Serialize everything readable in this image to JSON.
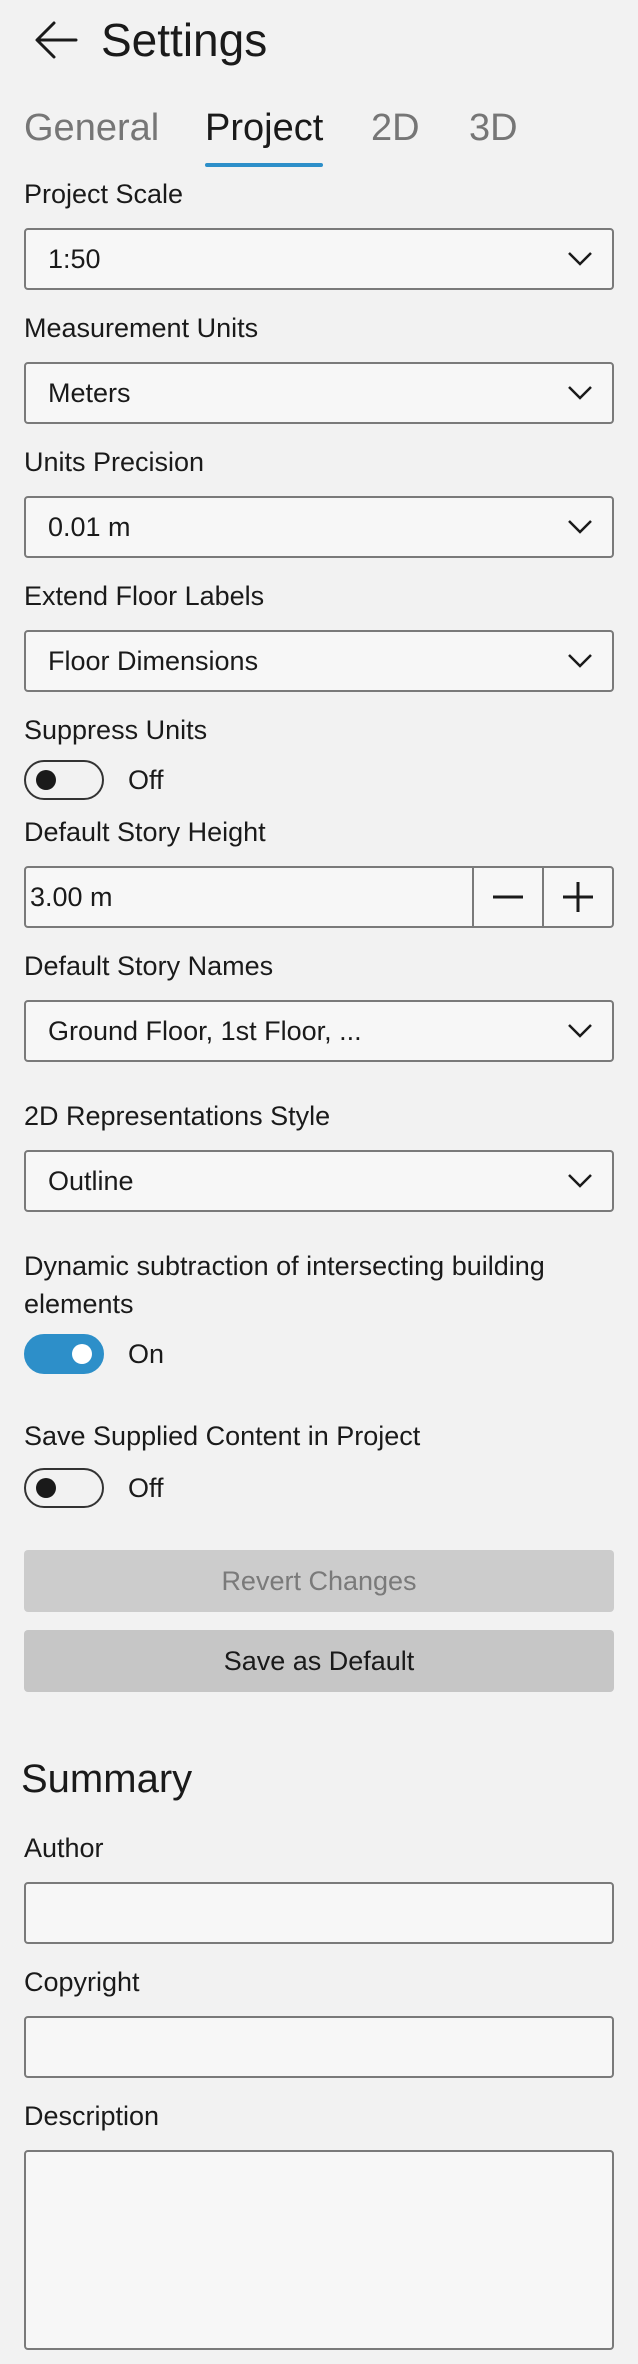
{
  "header": {
    "title": "Settings"
  },
  "tabs": [
    {
      "label": "General",
      "active": false
    },
    {
      "label": "Project",
      "active": true
    },
    {
      "label": "2D",
      "active": false
    },
    {
      "label": "3D",
      "active": false
    }
  ],
  "project": {
    "scale": {
      "label": "Project Scale",
      "value": "1:50"
    },
    "units": {
      "label": "Measurement Units",
      "value": "Meters"
    },
    "precision": {
      "label": "Units Precision",
      "value": "0.01 m"
    },
    "floor_labels": {
      "label": "Extend Floor Labels",
      "value": "Floor Dimensions"
    },
    "suppress_units": {
      "label": "Suppress Units",
      "state": "Off",
      "on": false
    },
    "story_height": {
      "label": "Default Story Height",
      "value": "3.00 m",
      "minus": "−",
      "plus": "+"
    },
    "story_names": {
      "label": "Default Story Names",
      "value": "Ground Floor, 1st Floor, ..."
    },
    "representation_style": {
      "label": "2D Representations Style",
      "value": "Outline"
    },
    "dynamic_subtraction": {
      "label_line1": "Dynamic subtraction of intersecting building",
      "label_line2": "elements",
      "state": "On",
      "on": true
    },
    "save_supplied": {
      "label": "Save Supplied Content in Project",
      "state": "Off",
      "on": false
    }
  },
  "actions": {
    "revert_label": "Revert Changes",
    "save_default_label": "Save as Default"
  },
  "summary": {
    "title": "Summary",
    "author": {
      "label": "Author",
      "value": ""
    },
    "copyright": {
      "label": "Copyright",
      "value": ""
    },
    "description": {
      "label": "Description",
      "value": ""
    }
  },
  "colors": {
    "accent": "#2d8fc9",
    "background": "#f2f2f2",
    "button": "#c6c6c6"
  }
}
